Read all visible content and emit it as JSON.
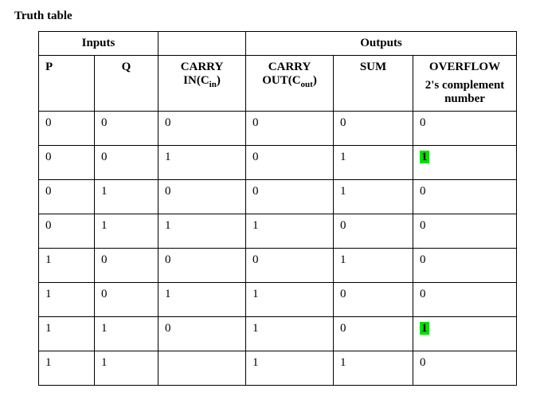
{
  "title": "Truth table",
  "headers": {
    "inputs_group": "Inputs",
    "outputs_group": "Outputs",
    "p": "P",
    "q": "Q",
    "carry_in": "CARRY IN(C",
    "carry_in_sub": "in",
    "carry_in_close": ")",
    "carry_out": "CARRY OUT(C",
    "carry_out_sub": "out",
    "carry_out_close": ")",
    "sum": "SUM",
    "overflow": "OVERFLOW",
    "overflow_sub": "2's complement number"
  },
  "chart_data": {
    "type": "table",
    "columns": [
      "P",
      "Q",
      "CARRY IN(Cin)",
      "CARRY OUT(Cout)",
      "SUM",
      "OVERFLOW"
    ],
    "rows": [
      {
        "p": "0",
        "q": "0",
        "cin": "0",
        "cout": "0",
        "sum": "0",
        "ov": "0",
        "hl": false
      },
      {
        "p": "0",
        "q": "0",
        "cin": "1",
        "cout": "0",
        "sum": "1",
        "ov": "1",
        "hl": true
      },
      {
        "p": "0",
        "q": "1",
        "cin": "0",
        "cout": "0",
        "sum": "1",
        "ov": "0",
        "hl": false
      },
      {
        "p": "0",
        "q": "1",
        "cin": "1",
        "cout": "1",
        "sum": "0",
        "ov": "0",
        "hl": false
      },
      {
        "p": "1",
        "q": "0",
        "cin": "0",
        "cout": "0",
        "sum": "1",
        "ov": "0",
        "hl": false
      },
      {
        "p": "1",
        "q": "0",
        "cin": "1",
        "cout": "1",
        "sum": "0",
        "ov": "0",
        "hl": false
      },
      {
        "p": "1",
        "q": "1",
        "cin": "0",
        "cout": "1",
        "sum": "0",
        "ov": "1",
        "hl": true
      },
      {
        "p": "1",
        "q": "1",
        "cin": "",
        "cout": "1",
        "sum": "1",
        "ov": "0",
        "hl": false
      }
    ]
  }
}
